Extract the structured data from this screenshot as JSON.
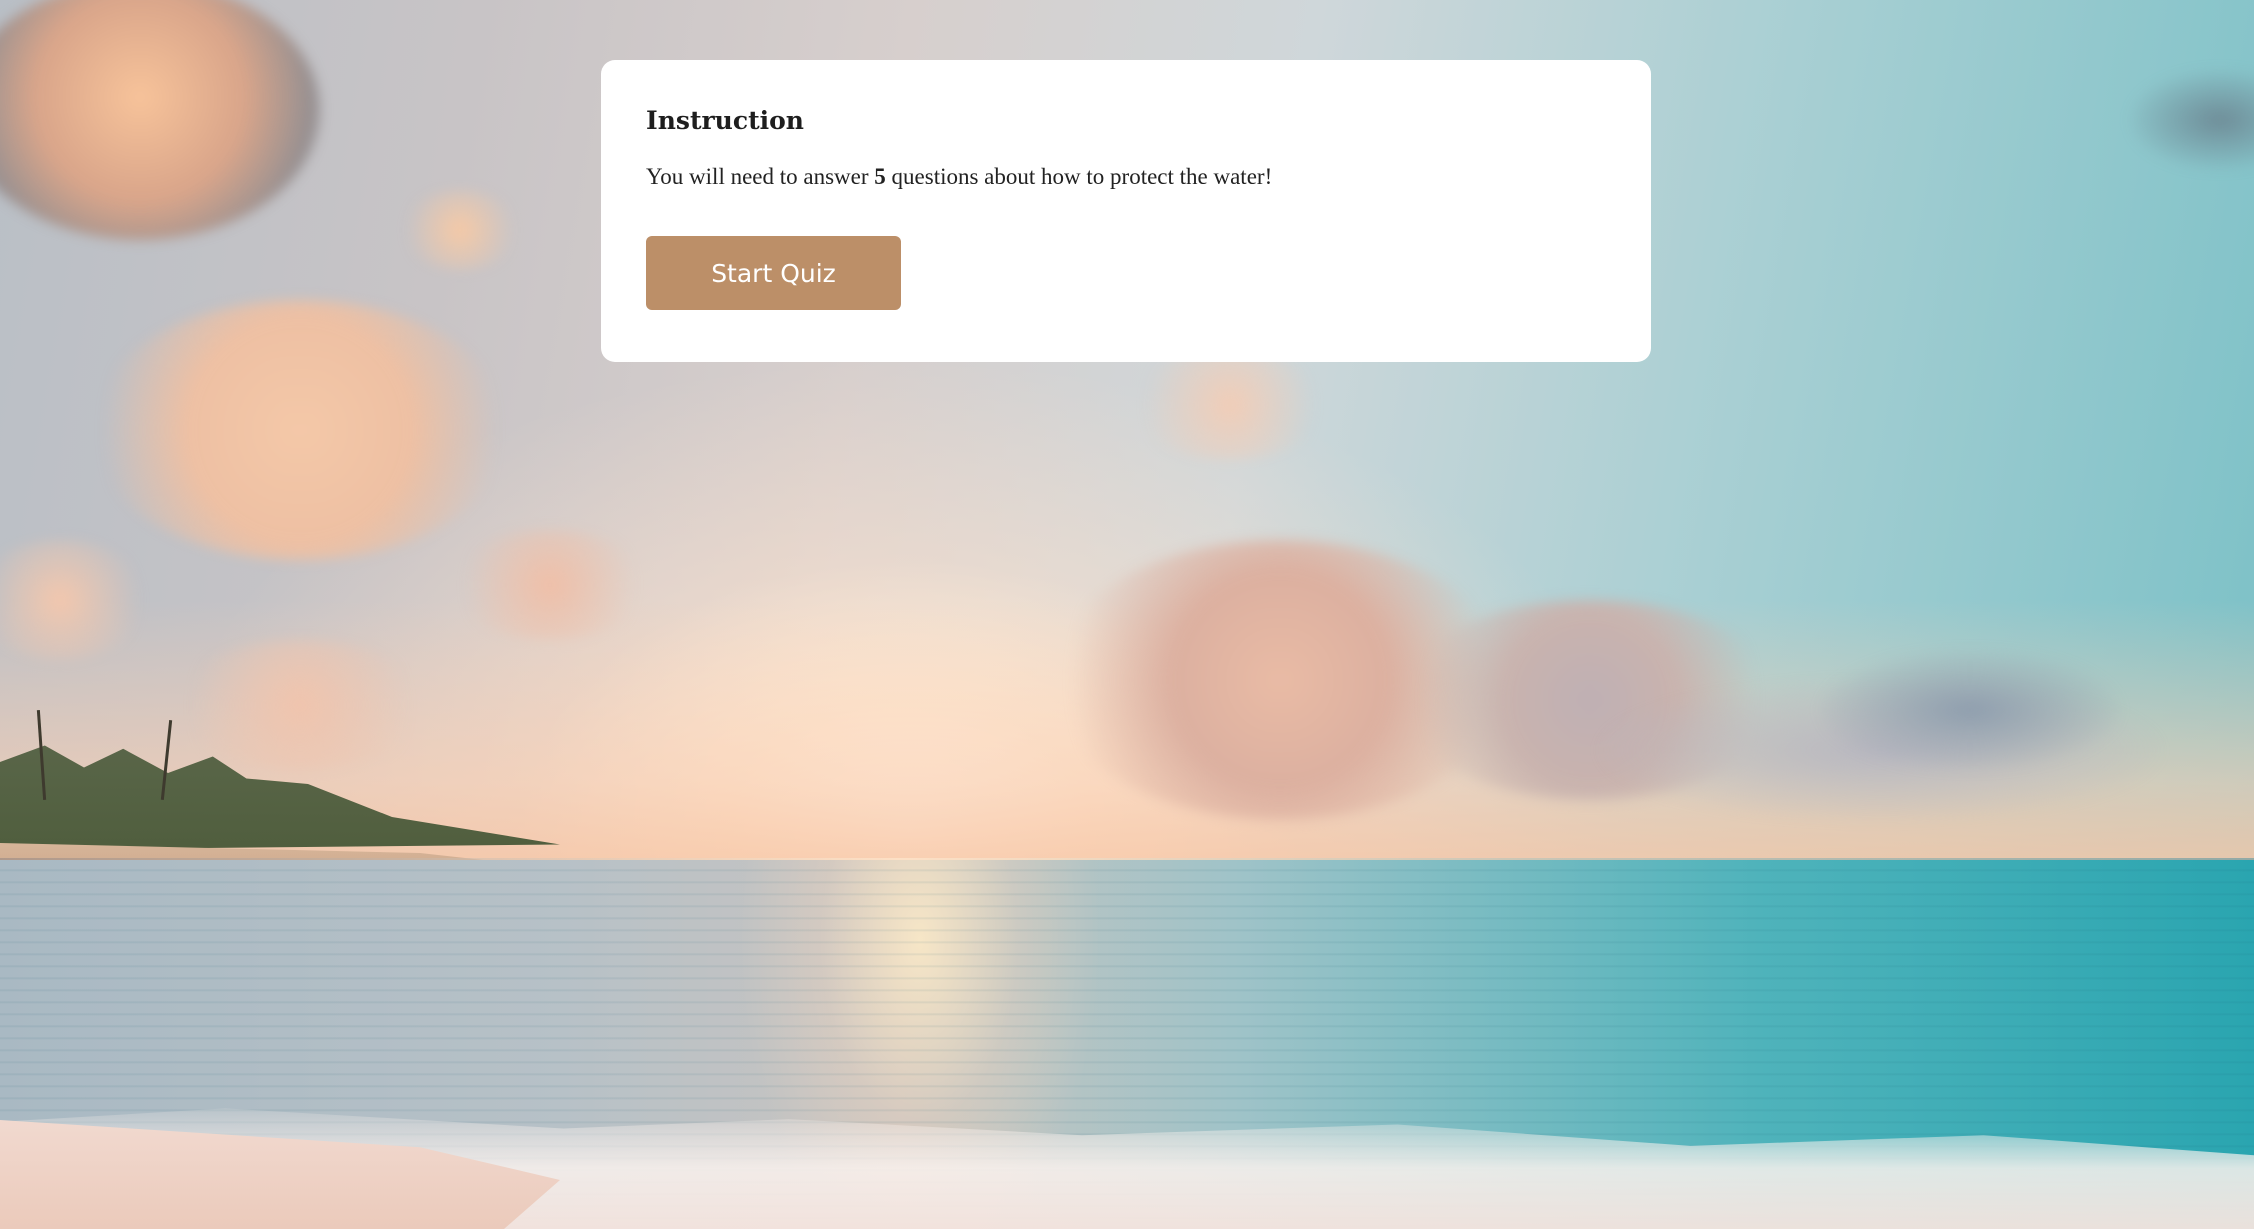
{
  "instruction": {
    "title": "Instruction",
    "text_before": "You will need to answer ",
    "question_count": "5",
    "text_after": " questions about how to protect the water!",
    "start_button_label": "Start Quiz"
  },
  "colors": {
    "card_background": "#ffffff",
    "button_background": "#bc8f68",
    "button_text": "#ffffff"
  },
  "background": {
    "image_subject": "beach-sunset-scene"
  }
}
